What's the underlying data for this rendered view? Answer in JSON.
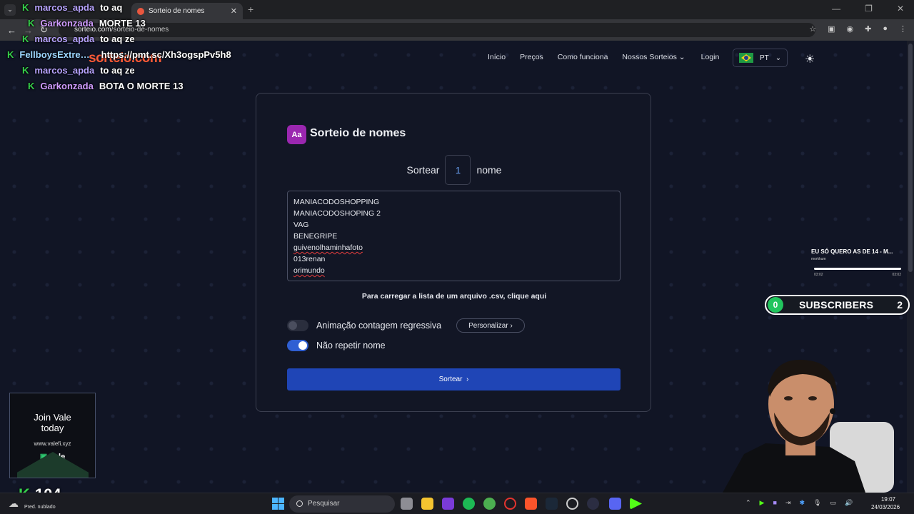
{
  "browser": {
    "tab_title": "Sorteio de nomes",
    "url_domain": "sorteio.com",
    "url_path": "/sorteio-de-nomes"
  },
  "site": {
    "logo": "sorteio.com",
    "nav": [
      "Início",
      "Preços",
      "Como funciona",
      "Nossos Sorteios",
      "Login"
    ],
    "language": "PT"
  },
  "card": {
    "badge": "Aa",
    "title": "Sorteio de nomes",
    "count_prefix": "Sortear",
    "count_value": "1",
    "count_suffix": "nome",
    "names": [
      "MANIACODOSHOPPING",
      "MANIACODOSHOPING 2",
      "VAG",
      "BENEGRIPE",
      "guivenolhaminhafoto",
      "013renan",
      "orimundo"
    ],
    "csv_text": "Para carregar a lista de um arquivo .csv, clique aqui",
    "countdown_label": "Animação contagem regressiva",
    "countdown_on": false,
    "customize_label": "Personalizar",
    "norepeat_label": "Não repetir nome",
    "norepeat_on": true,
    "submit_label": "Sortear"
  },
  "chat": [
    {
      "user": "marcos_apda",
      "msg": "to aq"
    },
    {
      "user": "Garkonzada",
      "msg": "MORTE 13"
    },
    {
      "user": "marcos_apda",
      "msg": "to aq ze"
    },
    {
      "user": "FellboysExtre…",
      "msg": "https://pmt.sc/Xh3ogspPv5h8"
    },
    {
      "user": "marcos_apda",
      "msg": "to aq ze"
    },
    {
      "user": "Garkonzada",
      "msg": "BOTA O MORTE 13"
    }
  ],
  "music_widget": {
    "title": "EU SÓ QUERO AS DE 14 - M...",
    "artist": "morkkum",
    "time_start": "03:02",
    "time_end": "03:02"
  },
  "subs_widget": {
    "current": "0",
    "label": "SUBSCRIBERS",
    "goal": "2"
  },
  "ad": {
    "line1": "Join Vale",
    "line2": "today",
    "url": "www.valefi.xyz",
    "brand": "Vale"
  },
  "stream": {
    "viewers": "104"
  },
  "taskbar": {
    "weather": "Pred. nublado",
    "search_placeholder": "Pesquisar",
    "time": "19:07",
    "date": "24/03/2026"
  },
  "colors": {
    "accent": "#1f45b6",
    "badge": "#9b27b0",
    "logo": "#ff5a36",
    "kick": "#36d14b"
  }
}
